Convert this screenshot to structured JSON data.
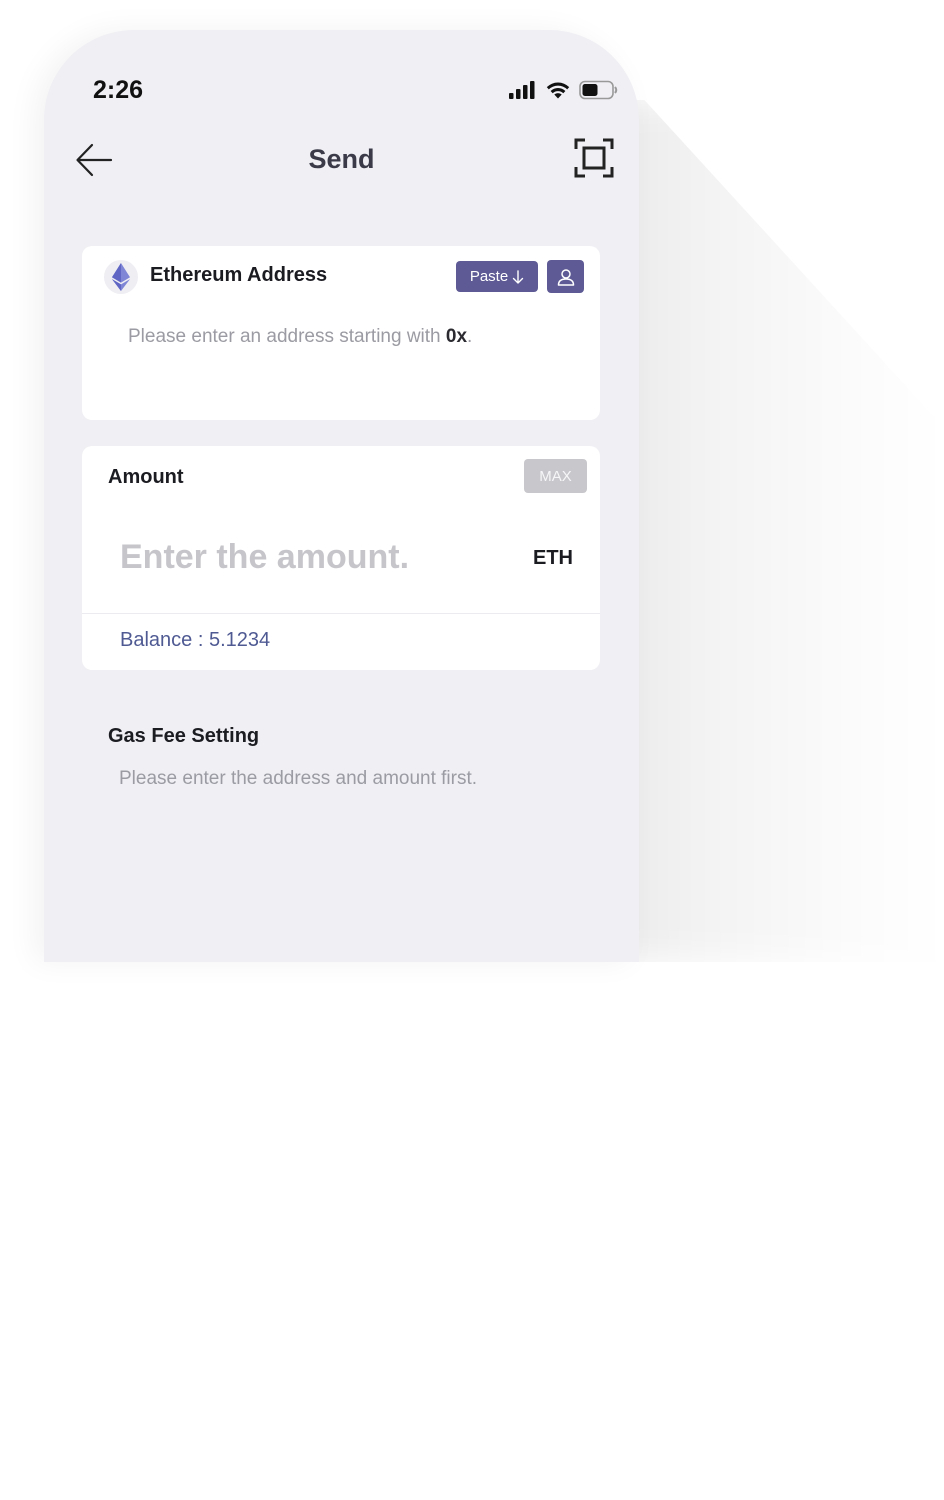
{
  "status_bar": {
    "time": "2:26",
    "icons": [
      "signal-icon",
      "wifi-icon",
      "battery-icon"
    ]
  },
  "header": {
    "title": "Send",
    "back_icon": "back-arrow-icon",
    "scan_icon": "scan-icon"
  },
  "address_card": {
    "label": "Ethereum Address",
    "coin_icon": "ethereum-icon",
    "paste_label": "Paste",
    "paste_icon": "arrow-down-icon",
    "contact_icon": "contact-icon",
    "placeholder_prefix": "Please enter an address starting with ",
    "placeholder_highlight": "0x",
    "placeholder_suffix": "."
  },
  "amount_card": {
    "label": "Amount",
    "max_label": "MAX",
    "placeholder": "Enter the amount.",
    "unit": "ETH",
    "balance": "Balance : 5.1234"
  },
  "gas_fee": {
    "title": "Gas Fee Setting",
    "note": "Please enter the address and amount first."
  },
  "colors": {
    "accent": "#5d5a95",
    "background": "#efeff4",
    "balance_text": "#4f5a93",
    "max_disabled": "#c8c8cc"
  }
}
